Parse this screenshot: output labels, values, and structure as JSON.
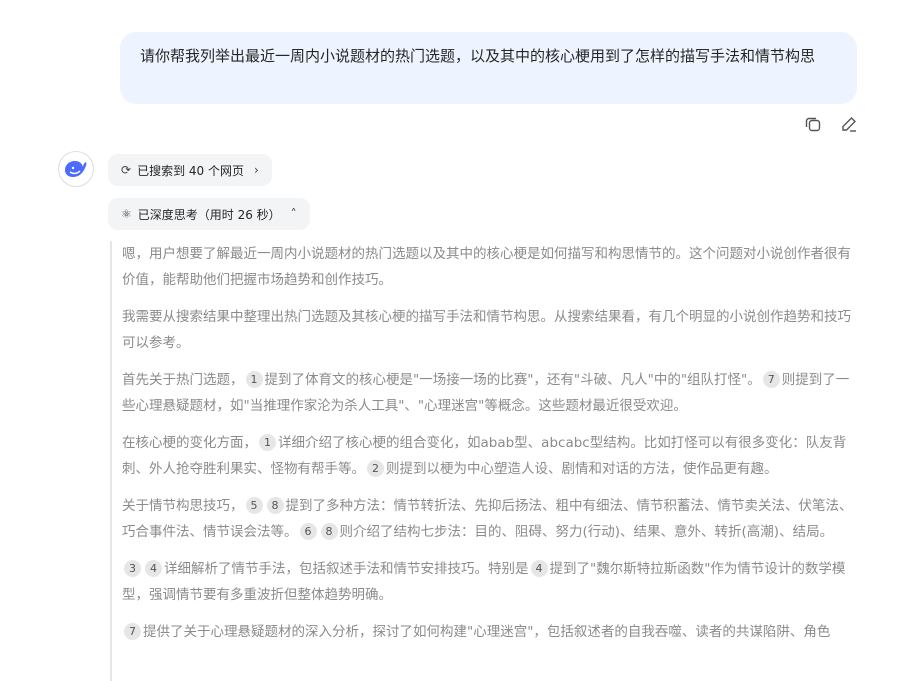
{
  "user_message": "请你帮我列举出最近一周内小说题材的热门选题，以及其中的核心梗用到了怎样的描写手法和情节构思",
  "actions": {
    "copy_icon": "copy-icon",
    "edit_icon": "edit-icon"
  },
  "avatar": {
    "icon": "whale-logo-icon",
    "color": "#4d6bfe"
  },
  "search_chip": {
    "label": "已搜索到 40 个网页",
    "icon": "refresh-icon",
    "chevron": "›"
  },
  "think_chip": {
    "label": "已深度思考（用时 26 秒）",
    "icon": "atom-icon",
    "chevron": "˄"
  },
  "thinking": {
    "p1": "嗯，用户想要了解最近一周内小说题材的热门选题以及其中的核心梗是如何描写和构思情节的。这个问题对小说创作者很有价值，能帮助他们把握市场趋势和创作技巧。",
    "p2": "我需要从搜索结果中整理出热门选题及其核心梗的描写手法和情节构思。从搜索结果看，有几个明显的小说创作趋势和技巧可以参考。",
    "p3": {
      "a": "首先关于热门选题，",
      "c1": "1",
      "b": "提到了体育文的核心梗是\"一场接一场的比赛\"，还有\"斗破、凡人\"中的\"组队打怪\"。",
      "c2": "7",
      "d": "则提到了一些心理悬疑题材，如\"当推理作家沦为杀人工具\"、\"心理迷宫\"等概念。这些题材最近很受欢迎。"
    },
    "p4": {
      "a": "在核心梗的变化方面，",
      "c1": "1",
      "b": "详细介绍了核心梗的组合变化，如abab型、abcabc型结构。比如打怪可以有很多变化：队友背刺、外人抢夺胜利果实、怪物有帮手等。",
      "c2": "2",
      "d": "则提到以梗为中心塑造人设、剧情和对话的方法，使作品更有趣。"
    },
    "p5": {
      "a": "关于情节构思技巧，",
      "c1": "5",
      "c2": "8",
      "b": "提到了多种方法：情节转折法、先抑后扬法、粗中有细法、情节积蓄法、情节卖关法、伏笔法、巧合事件法、情节误会法等。",
      "c3": "6",
      "c4": "8",
      "d": "则介绍了结构七步法：目的、阻碍、努力(行动)、结果、意外、转折(高潮)、结局。"
    },
    "p6": {
      "c1": "3",
      "c2": "4",
      "a": "详细解析了情节手法，包括叙述手法和情节安排技巧。特别是",
      "c3": "4",
      "b": "提到了\"魏尔斯特拉斯函数\"作为情节设计的数学模型，强调情节要有多重波折但整体趋势明确。"
    },
    "p7": {
      "c1": "7",
      "a": "提供了关于心理悬疑题材的深入分析，探讨了如何构建\"心理迷宫\"，包括叙述者的自我吞噬、读者的共谋陷阱、角色"
    }
  }
}
